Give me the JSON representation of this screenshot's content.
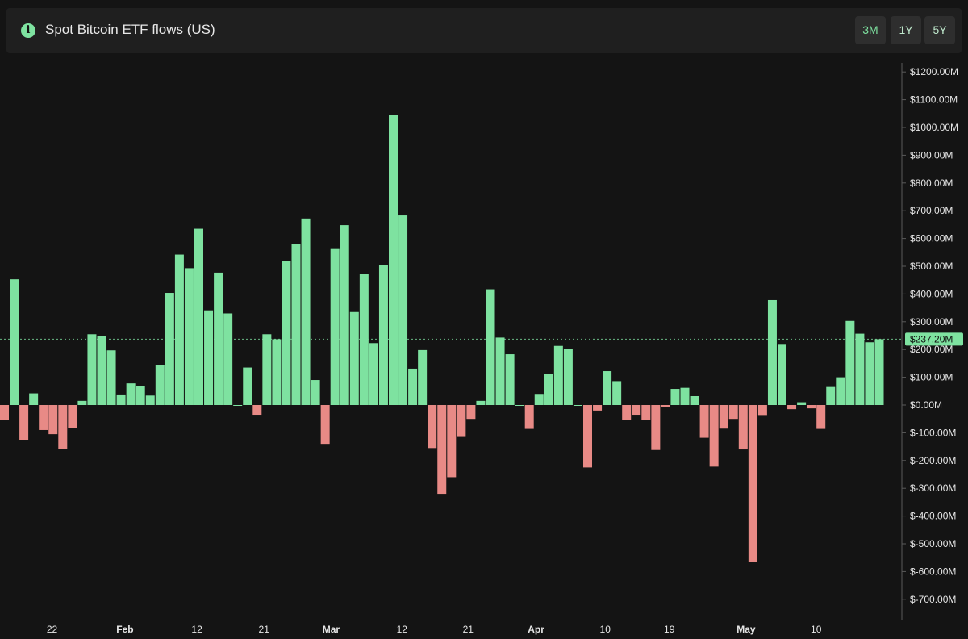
{
  "header": {
    "title": "Spot Bitcoin ETF flows (US)",
    "info_icon": "info-icon",
    "ranges": [
      "3M",
      "1Y",
      "5Y"
    ]
  },
  "colors": {
    "background": "#141414",
    "header_bg": "#1f1f1f",
    "positive": "#7ee2a0",
    "negative": "#e88a86",
    "text": "#e6e6e6"
  },
  "chart_data": {
    "type": "bar",
    "title": "Spot Bitcoin ETF flows (US)",
    "current_value_label": "$237.20M",
    "current_value": 237.2,
    "unit": "$M",
    "ylim": [
      -780,
      1280
    ],
    "y_ticks": [
      1200,
      1100,
      1000,
      900,
      800,
      700,
      600,
      500,
      400,
      300,
      200,
      100,
      0,
      -100,
      -200,
      -300,
      -400,
      -500,
      -600,
      -700
    ],
    "y_tick_labels": [
      "$1200.00M",
      "$1100.00M",
      "$1000.00M",
      "$900.00M",
      "$800.00M",
      "$700.00M",
      "$600.00M",
      "$500.00M",
      "$400.00M",
      "$300.00M",
      "$200.00M",
      "$100.00M",
      "$0.00M",
      "$-100.00M",
      "$-200.00M",
      "$-300.00M",
      "$-400.00M",
      "$-500.00M",
      "$-600.00M",
      "$-700.00M"
    ],
    "x_labels": [
      {
        "text": "22",
        "index": 4.9,
        "bold": false
      },
      {
        "text": "Feb",
        "index": 12.4,
        "bold": true
      },
      {
        "text": "12",
        "index": 19.8,
        "bold": false
      },
      {
        "text": "21",
        "index": 26.7,
        "bold": false
      },
      {
        "text": "Mar",
        "index": 33.6,
        "bold": true
      },
      {
        "text": "12",
        "index": 40.9,
        "bold": false
      },
      {
        "text": "21",
        "index": 47.7,
        "bold": false
      },
      {
        "text": "Apr",
        "index": 54.7,
        "bold": true
      },
      {
        "text": "10",
        "index": 61.8,
        "bold": false
      },
      {
        "text": "19",
        "index": 68.4,
        "bold": false
      },
      {
        "text": "May",
        "index": 76.3,
        "bold": true
      },
      {
        "text": "10",
        "index": 83.5,
        "bold": false
      }
    ],
    "values": [
      -55,
      453,
      -125,
      42,
      -90,
      -105,
      -157,
      -82,
      15,
      255,
      248,
      197,
      38,
      78,
      67,
      34,
      145,
      404,
      542,
      493,
      635,
      341,
      477,
      330,
      0,
      135,
      -35,
      255,
      237,
      520,
      580,
      672,
      90,
      -140,
      562,
      648,
      335,
      472,
      223,
      505,
      1045,
      683,
      131,
      198,
      -155,
      -320,
      -260,
      -115,
      -50,
      15,
      417,
      243,
      183,
      0,
      -86,
      40,
      112,
      213,
      203,
      0,
      -225,
      -20,
      122,
      86,
      -55,
      -35,
      -55,
      -162,
      -8,
      58,
      62,
      32,
      -118,
      -222,
      -85,
      -50,
      -160,
      -564,
      -36,
      378,
      220,
      -15,
      10,
      -12,
      -86,
      65,
      100,
      303,
      257,
      226,
      237
    ]
  }
}
